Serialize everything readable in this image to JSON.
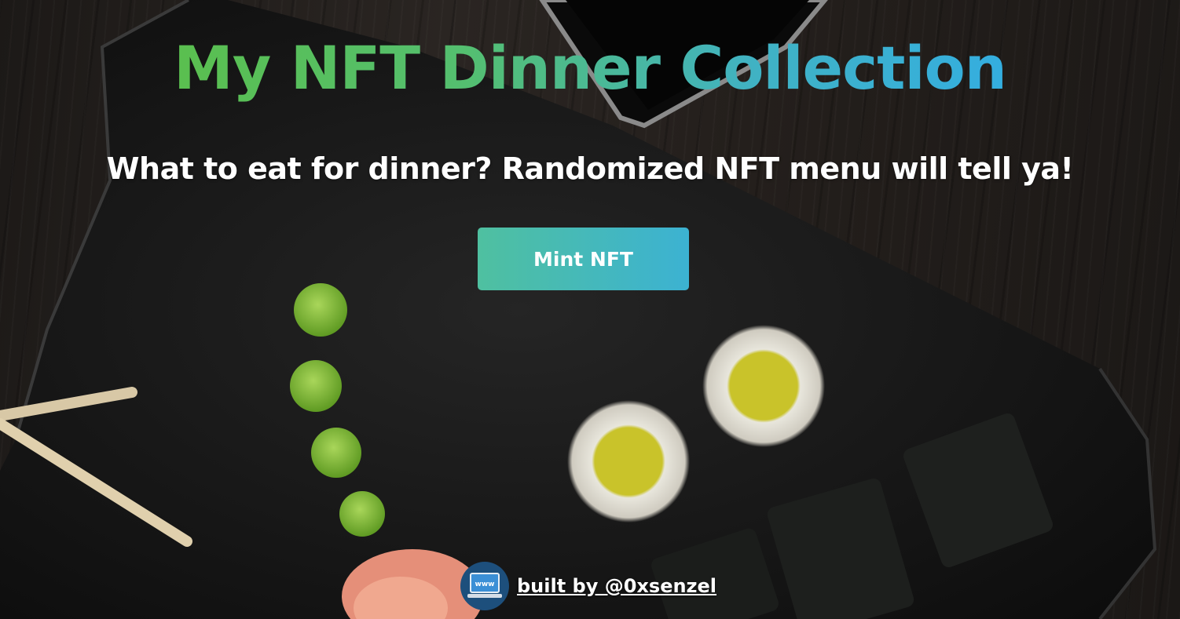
{
  "header": {
    "title": "My NFT Dinner Collection",
    "subtitle": "What to eat for dinner? Randomized NFT menu will tell ya!"
  },
  "actions": {
    "mint_label": "Mint NFT"
  },
  "footer": {
    "logo_text": "www",
    "link_text": "built by @0xsenzel"
  },
  "colors": {
    "title_gradient_start": "#5abf4f",
    "title_gradient_end": "#34aee0",
    "button_gradient_start": "#4fc0a0",
    "button_gradient_end": "#3cb2d2"
  },
  "background": {
    "scene": "sushi-on-slate-photo"
  }
}
